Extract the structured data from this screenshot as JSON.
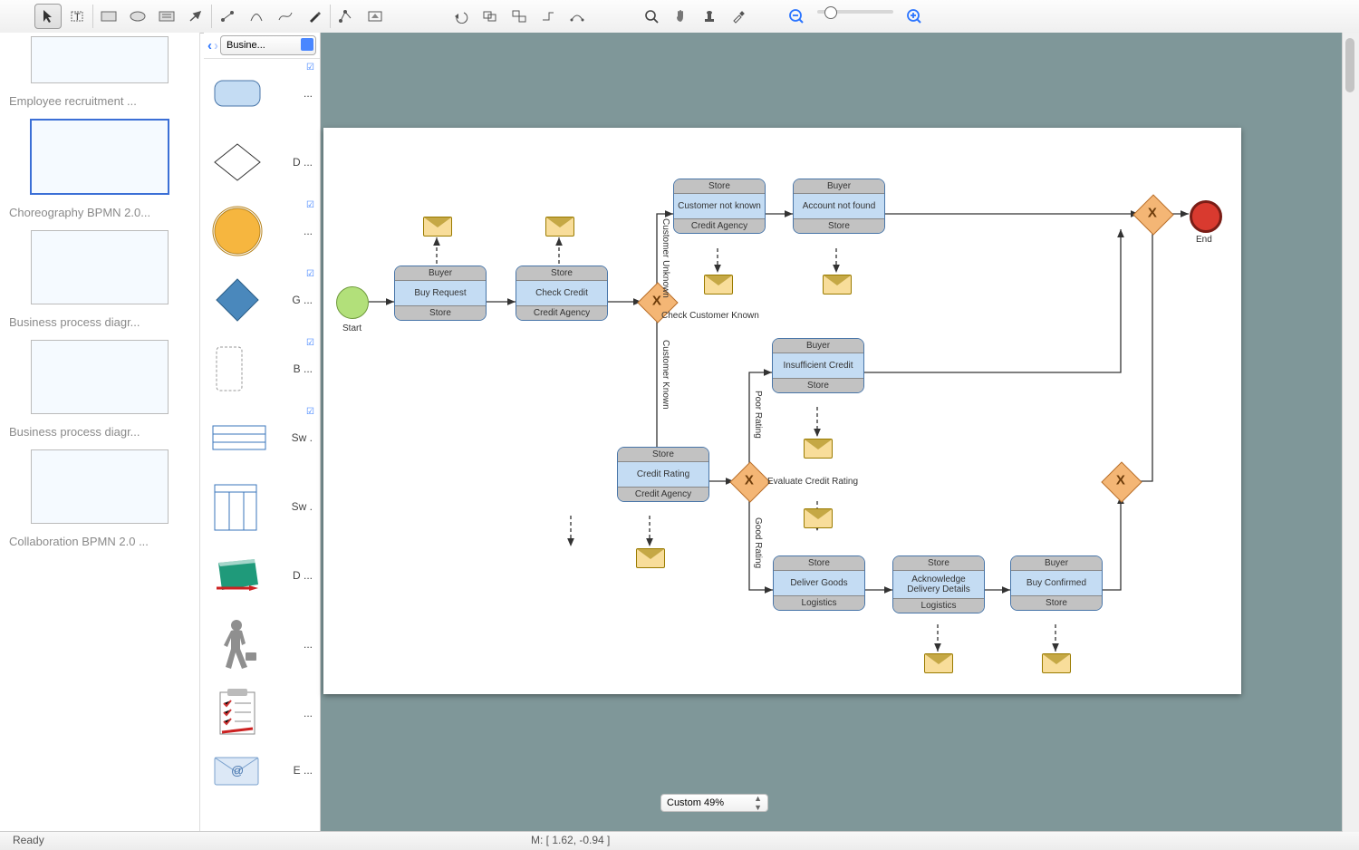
{
  "toolbar": {
    "groups": {
      "g1": [
        "pointer",
        "text",
        "rect",
        "ellipse",
        "textbox",
        "arrow-up",
        "connector",
        "curve",
        "freehand",
        "pen",
        "shape-edit",
        "insert"
      ],
      "g2": [
        "undo",
        "group",
        "ungroup",
        "connect",
        "route"
      ],
      "g3": [
        "zoom-fit",
        "pan",
        "stamp",
        "eyedropper"
      ],
      "g4": [
        "zoom-out",
        "zoom-slider",
        "zoom-in"
      ]
    }
  },
  "pages": [
    {
      "label": "",
      "sel": false
    },
    {
      "label": "Employee recruitment ...",
      "sel": false
    },
    {
      "label": "",
      "sel": true
    },
    {
      "label": "Choreography BPMN 2.0...",
      "sel": false
    },
    {
      "label": "",
      "sel": false
    },
    {
      "label": "Business process diagr...",
      "sel": false
    },
    {
      "label": "",
      "sel": false
    },
    {
      "label": "Business process diagr...",
      "sel": false
    },
    {
      "label": "",
      "sel": false
    },
    {
      "label": "Collaboration BPMN 2.0 ...",
      "sel": false
    }
  ],
  "shapepanel": {
    "select": "Busine...",
    "items": [
      {
        "label": "...",
        "kind": "rounded"
      },
      {
        "label": "D ...",
        "kind": "diamond"
      },
      {
        "label": "...",
        "kind": "circle"
      },
      {
        "label": "G ...",
        "kind": "bluediamond"
      },
      {
        "label": "B ...",
        "kind": "dashrect"
      },
      {
        "label": "Sw .",
        "kind": "swim1"
      },
      {
        "label": "Sw .",
        "kind": "swim2"
      },
      {
        "label": "D ...",
        "kind": "book"
      },
      {
        "label": "...",
        "kind": "runner"
      },
      {
        "label": "...",
        "kind": "checklist"
      },
      {
        "label": "E ...",
        "kind": "mail"
      }
    ]
  },
  "canvas": {
    "start": {
      "label": "Start"
    },
    "end": {
      "label": "End"
    },
    "gateways": {
      "g1": "Check Customer Known",
      "g2": "Evaluate Credit Rating",
      "g3": "",
      "g4": ""
    },
    "edges": {
      "e1": "Customer Unknown",
      "e2": "Customer Known",
      "e3": "Poor Rating",
      "e4": "Good Rating"
    },
    "tasks": {
      "buy": {
        "top": "Buyer",
        "body": "Buy Request",
        "bottom": "Store"
      },
      "check": {
        "top": "Store",
        "body": "Check Credit",
        "bottom": "Credit Agency"
      },
      "notknown": {
        "top": "Store",
        "body": "Customer not known",
        "bottom": "Credit Agency"
      },
      "acct": {
        "top": "Buyer",
        "body": "Account not found",
        "bottom": "Store"
      },
      "rating": {
        "top": "Store",
        "body": "Credit Rating",
        "bottom": "Credit Agency"
      },
      "insuf": {
        "top": "Buyer",
        "body": "Insufficient Credit",
        "bottom": "Store"
      },
      "deliver": {
        "top": "Store",
        "body": "Deliver Goods",
        "bottom": "Logistics"
      },
      "ack": {
        "top": "Store",
        "body": "Acknowledge Delivery Details",
        "bottom": "Logistics"
      },
      "confirm": {
        "top": "Buyer",
        "body": "Buy Confirmed",
        "bottom": "Store"
      }
    }
  },
  "zoom": "Custom 49%",
  "status": {
    "ready": "Ready",
    "mouse": "M: [ 1.62, -0.94 ]"
  }
}
